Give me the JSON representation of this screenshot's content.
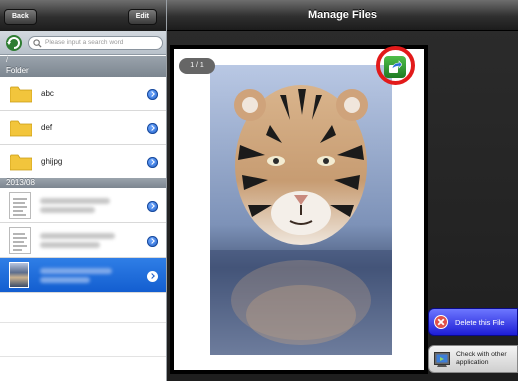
{
  "left_nav": {
    "back_label": "Back",
    "edit_label": "Edit"
  },
  "search": {
    "placeholder": "Please input a search word"
  },
  "path_section": {
    "path": "/",
    "title": "Folder"
  },
  "folders": [
    {
      "label": "abc",
      "icon": "folder-icon"
    },
    {
      "label": "def",
      "icon": "folder-icon"
    },
    {
      "label": "ghijpg",
      "icon": "folder-icon"
    }
  ],
  "date_section": {
    "title": "2013/08"
  },
  "files": [
    {
      "name": "",
      "thumb": "document-thumbnail",
      "selected": false
    },
    {
      "name": "",
      "thumb": "document-thumbnail",
      "selected": false
    },
    {
      "name": "",
      "thumb": "image-thumbnail",
      "selected": true
    }
  ],
  "header": {
    "title": "Manage Files"
  },
  "preview": {
    "page_indicator": "1 / 1"
  },
  "actions": {
    "delete_label": "Delete this File",
    "check_label": "Check with other application"
  },
  "colors": {
    "selection": "#1d64d8",
    "highlight": "#e21a1a",
    "share_button": "#2f9a32",
    "delete_button": "#2a2ae0"
  }
}
